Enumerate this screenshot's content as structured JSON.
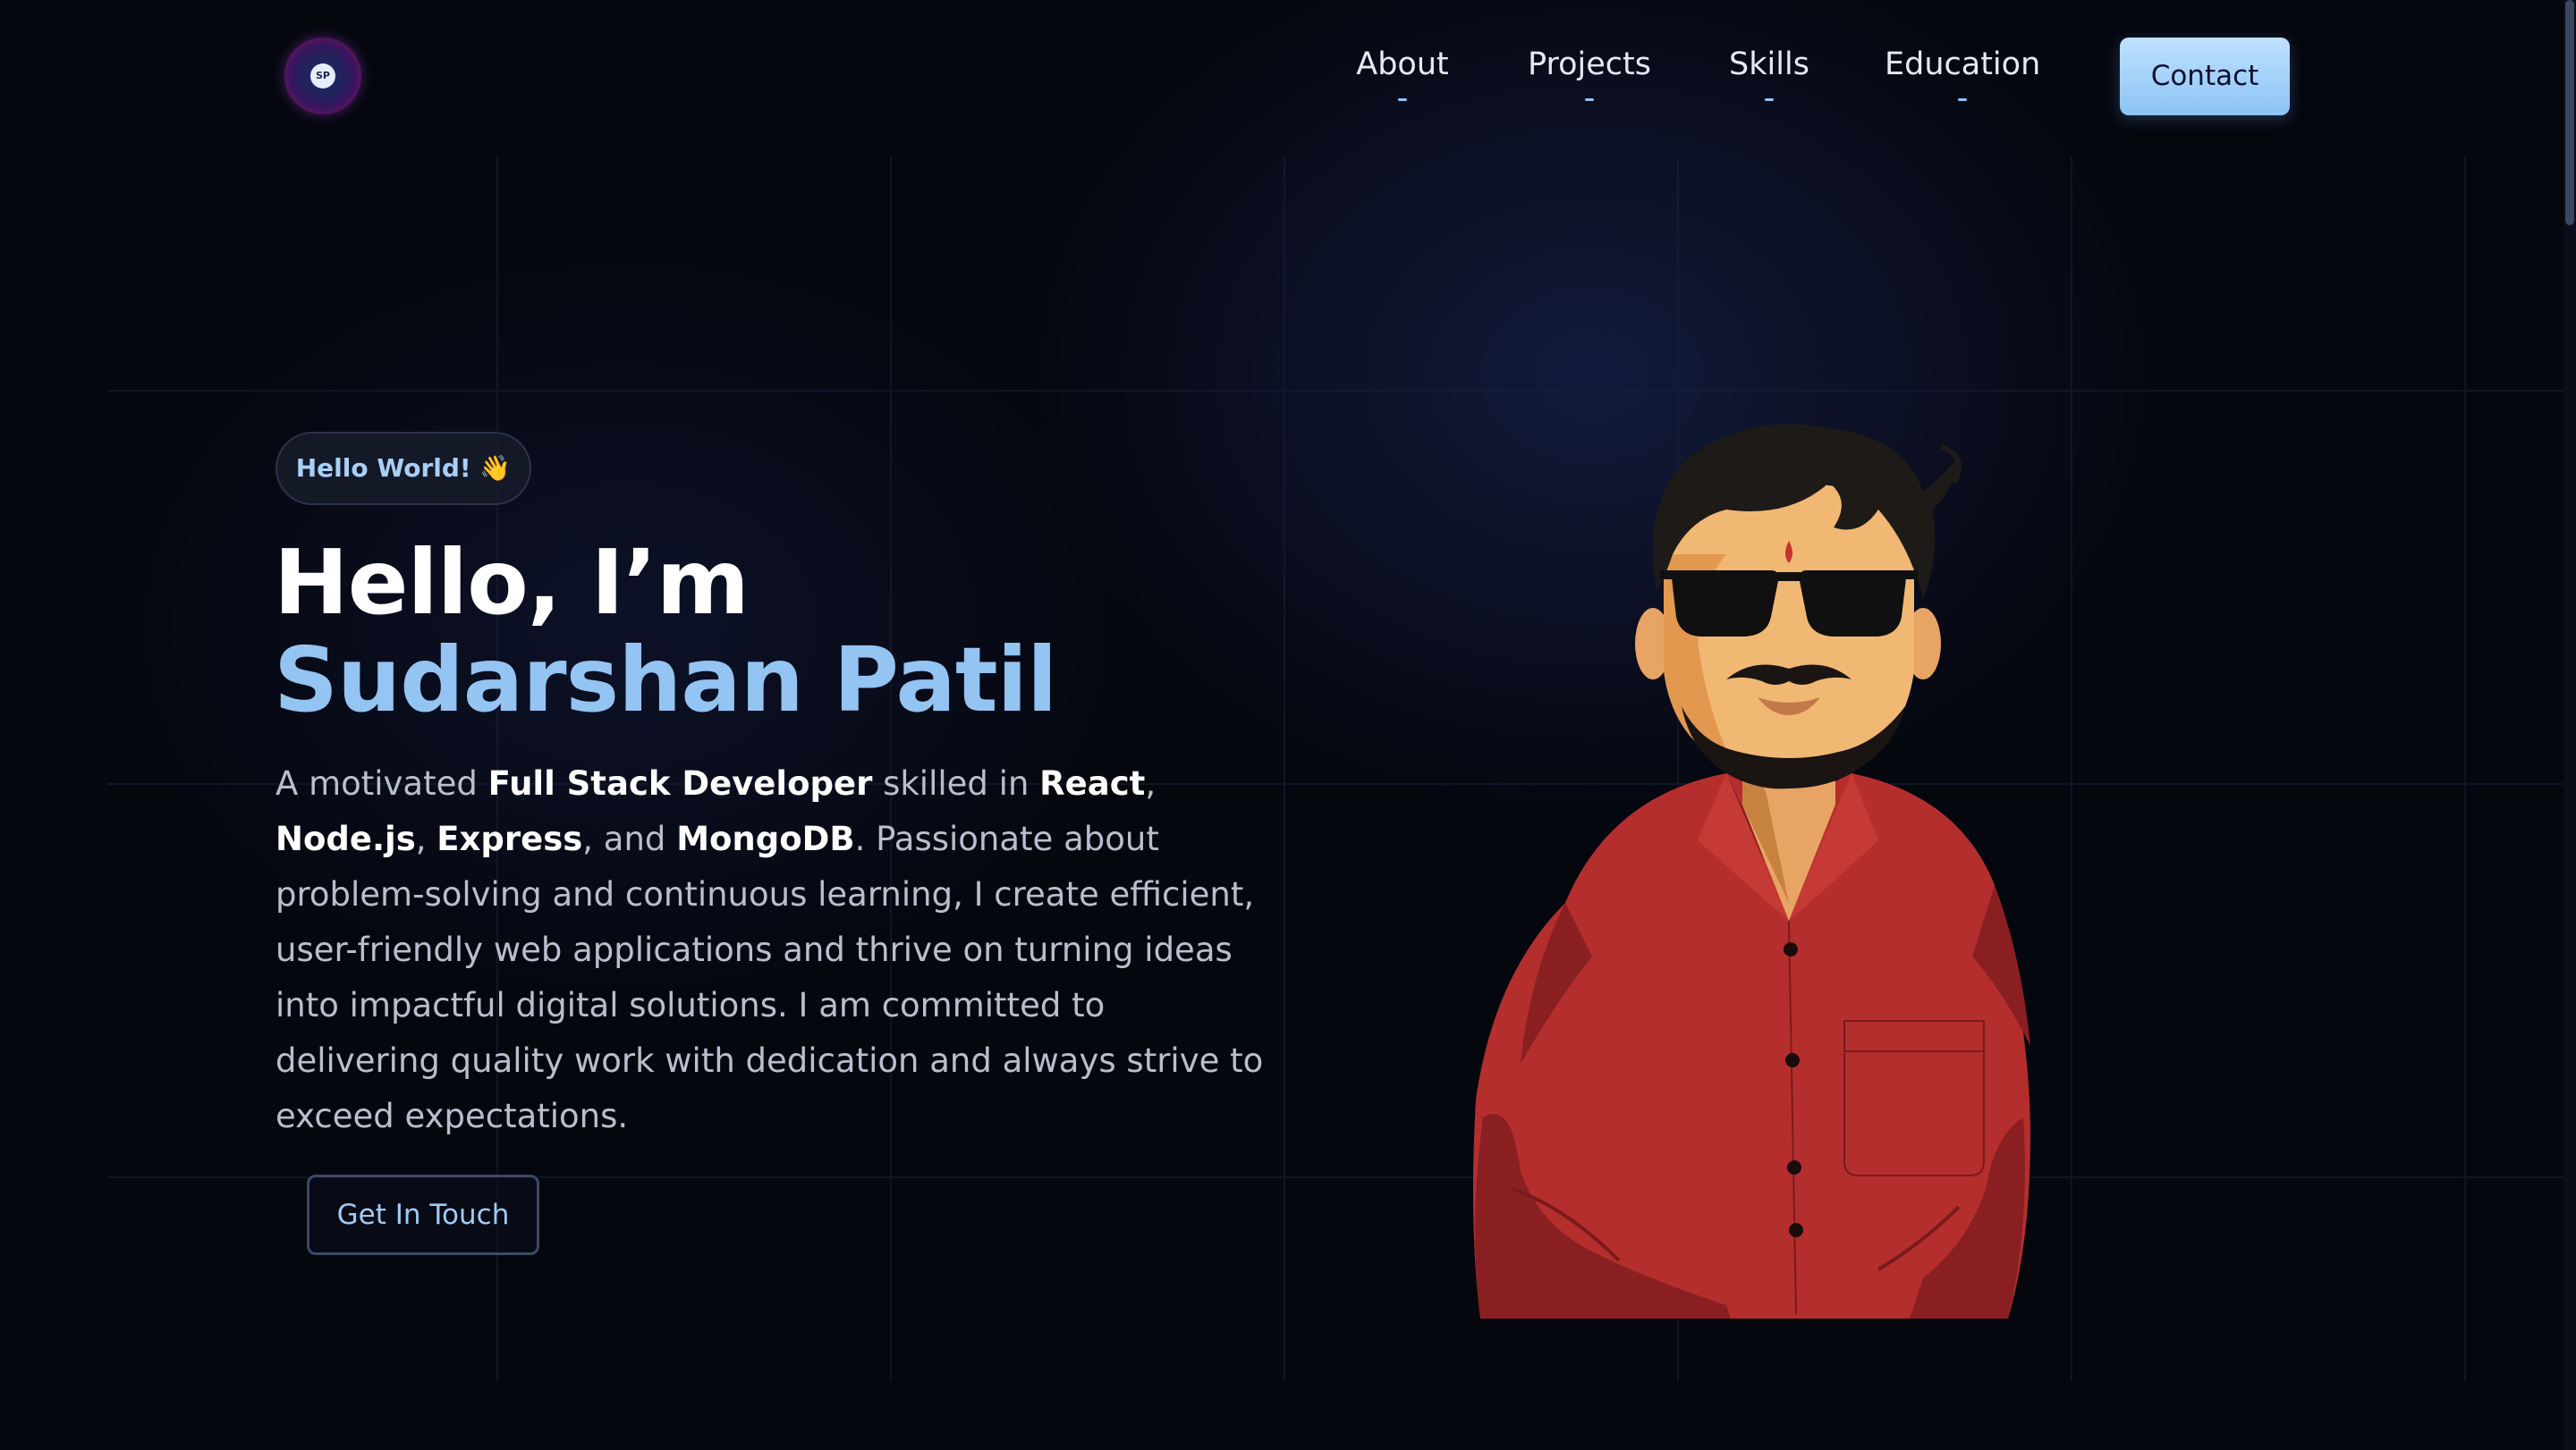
{
  "header": {
    "logo_text": "SP",
    "nav": [
      {
        "label": "About"
      },
      {
        "label": "Projects"
      },
      {
        "label": "Skills"
      },
      {
        "label": "Education"
      }
    ],
    "contact_label": "Contact"
  },
  "hero": {
    "badge": "Hello World! 👋",
    "greeting": "Hello, I’m",
    "name": "Sudarshan Patil",
    "description": {
      "p1": "A motivated ",
      "role": "Full Stack Developer",
      "p2": " skilled in ",
      "skill1": "React",
      "sep1": ", ",
      "skill2": "Node.js",
      "sep2": ", ",
      "skill3": "Express",
      "sep3": ", and ",
      "skill4": "MongoDB",
      "p3": ". Passionate about problem-solving and continuous learning, I create efficient, user-friendly web applications and thrive on turning ideas into impactful digital solutions. I am committed to delivering quality work with dedication and always strive to exceed expectations."
    },
    "cta_label": "Get In Touch"
  },
  "colors": {
    "background": "#05070f",
    "accent": "#93c4f2",
    "shirt": "#b72f2f",
    "contact_button": "#a6d2fa"
  },
  "icons": {
    "logo": "sp-logo-icon",
    "avatar": "developer-avatar-illustration"
  }
}
